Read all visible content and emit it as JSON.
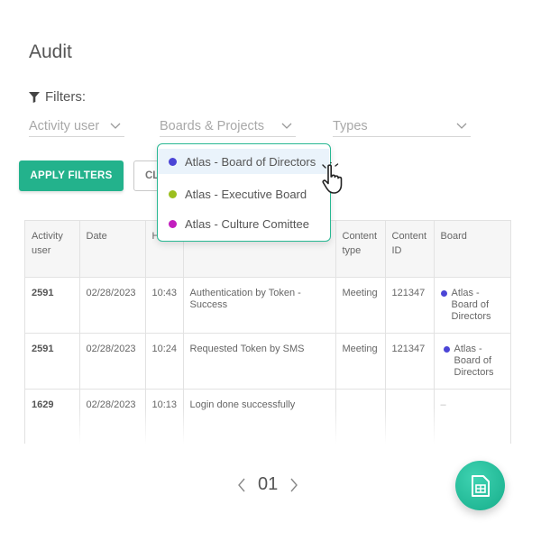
{
  "page": {
    "title": "Audit"
  },
  "filters": {
    "label": "Filters:",
    "activity_user_placeholder": "Activity user",
    "boards_placeholder": "Boards & Projects",
    "types_placeholder": "Types"
  },
  "buttons": {
    "apply": "APPLY FILTERS",
    "clear": "CL"
  },
  "dropdown": {
    "items": [
      {
        "label": "Atlas - Board of Directors",
        "color": "#4b45d6"
      },
      {
        "label": "Atlas - Executive Board",
        "color": "#9bbf1e"
      },
      {
        "label": "Atlas - Culture Comittee",
        "color": "#c21fbe"
      }
    ]
  },
  "table": {
    "headers": [
      "Activity user",
      "Date",
      "H",
      "",
      "Content type",
      "Content ID",
      "Board"
    ],
    "rows": [
      {
        "user": "2591",
        "date": "02/28/2023",
        "hour": "10:43",
        "activity": "Authentication by Token - Success",
        "content_type": "Meeting",
        "content_id": "121347",
        "board": "Atlas - Board of Directors"
      },
      {
        "user": "2591",
        "date": "02/28/2023",
        "hour": "10:24",
        "activity": "Requested Token by SMS",
        "content_type": "Meeting",
        "content_id": "121347",
        "board": "Atlas - Board of Directors"
      },
      {
        "user": "1629",
        "date": "02/28/2023",
        "hour": "10:13",
        "activity": "Login done successfully",
        "content_type": "",
        "content_id": "",
        "board": "–"
      }
    ]
  },
  "pagination": {
    "page": "01"
  },
  "colors": {
    "accent": "#23b28c",
    "board_dot": "#4b45d6"
  },
  "icons": {
    "filter": "filter-funnel-icon",
    "chevron": "chevron-down-icon",
    "cursor": "hand-pointer-icon",
    "prev": "chevron-left-icon",
    "next": "chevron-right-icon",
    "fab": "export-sheet-icon"
  }
}
